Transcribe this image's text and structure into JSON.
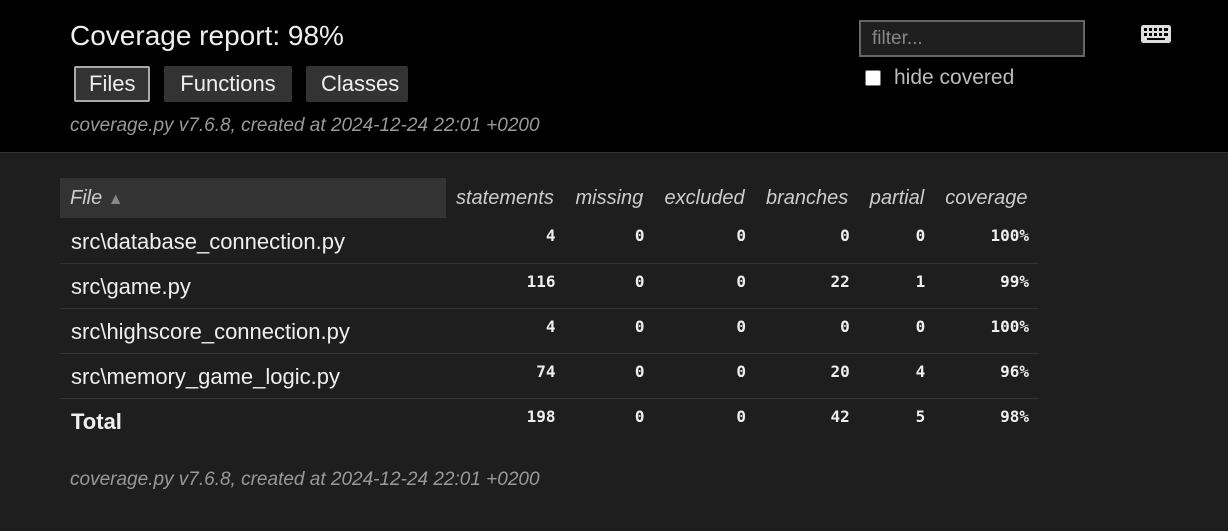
{
  "header": {
    "title": "Coverage report: 98%",
    "tabs": [
      {
        "label": "Files",
        "current": true
      },
      {
        "label": "Functions",
        "current": false
      },
      {
        "label": "Classes",
        "current": false
      }
    ],
    "created": "coverage.py v7.6.8, created at 2024-12-24 22:01 +0200",
    "filter_placeholder": "filter...",
    "hide_covered_label": "hide covered",
    "hide_covered_checked": false,
    "keyboard_icon": "keyboard-icon"
  },
  "table": {
    "columns": [
      "File",
      "statements",
      "missing",
      "excluded",
      "branches",
      "partial",
      "coverage"
    ],
    "sort_indicator": "▲",
    "rows": [
      {
        "file": "src\\database_connection.py",
        "statements": "4",
        "missing": "0",
        "excluded": "0",
        "branches": "0",
        "partial": "0",
        "coverage": "100%"
      },
      {
        "file": "src\\game.py",
        "statements": "116",
        "missing": "0",
        "excluded": "0",
        "branches": "22",
        "partial": "1",
        "coverage": "99%"
      },
      {
        "file": "src\\highscore_connection.py",
        "statements": "4",
        "missing": "0",
        "excluded": "0",
        "branches": "0",
        "partial": "0",
        "coverage": "100%"
      },
      {
        "file": "src\\memory_game_logic.py",
        "statements": "74",
        "missing": "0",
        "excluded": "0",
        "branches": "20",
        "partial": "4",
        "coverage": "96%"
      }
    ],
    "total": {
      "file": "Total",
      "statements": "198",
      "missing": "0",
      "excluded": "0",
      "branches": "42",
      "partial": "5",
      "coverage": "98%"
    }
  },
  "footer": {
    "created": "coverage.py v7.6.8, created at 2024-12-24 22:01 +0200"
  },
  "colors": {
    "header_bg": "#000000",
    "body_bg": "#1e1e1e",
    "text": "#eeeeee",
    "muted": "#999999"
  }
}
